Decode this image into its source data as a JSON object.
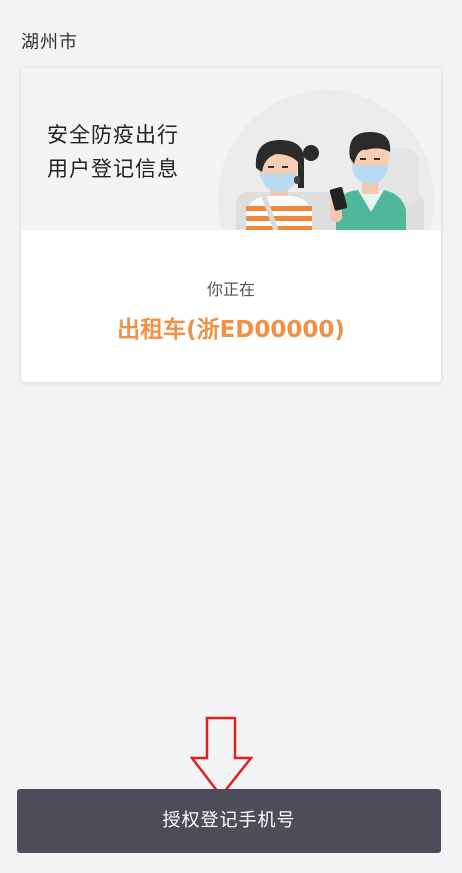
{
  "header": {
    "city": "湖州市"
  },
  "card": {
    "headline_line1": "安全防疫出行",
    "headline_line2": "用户登记信息",
    "status_label": "你正在",
    "vehicle": "出租车(浙ED00000)"
  },
  "action": {
    "button_label": "授权登记手机号"
  },
  "colors": {
    "background": "#f2f3f5",
    "accent_orange": "#ef9147",
    "button_bg": "#4d4d59",
    "arrow_red": "#e02020",
    "mask_blue": "#b7dcf4",
    "jacket_teal": "#4fb89a"
  },
  "icons": {
    "illustration": "masked-passengers-illustration",
    "arrow": "down-arrow-icon"
  }
}
